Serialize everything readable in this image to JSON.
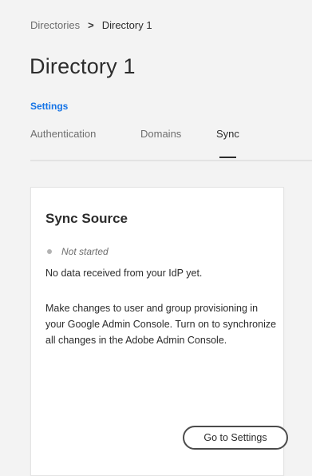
{
  "breadcrumb": {
    "root": "Directories",
    "separator": ">",
    "current": "Directory 1"
  },
  "page": {
    "title": "Directory 1",
    "section_label": "Settings"
  },
  "tabs": [
    {
      "label": "Authentication",
      "active": false
    },
    {
      "label": "Domains",
      "active": false
    },
    {
      "label": "Sync",
      "active": true
    }
  ],
  "card": {
    "title": "Sync Source",
    "status": "Not started",
    "status_color": "#b3b3b3",
    "no_data_text": "No data received from your IdP yet.",
    "description": "Make changes to user and group provisioning in your Google Admin Console. Turn on to synchronize all changes in the Adobe Admin Console.",
    "button_label": "Go to Settings"
  },
  "colors": {
    "accent": "#1473e6",
    "background": "#f3f3f3",
    "card_background": "#ffffff"
  }
}
